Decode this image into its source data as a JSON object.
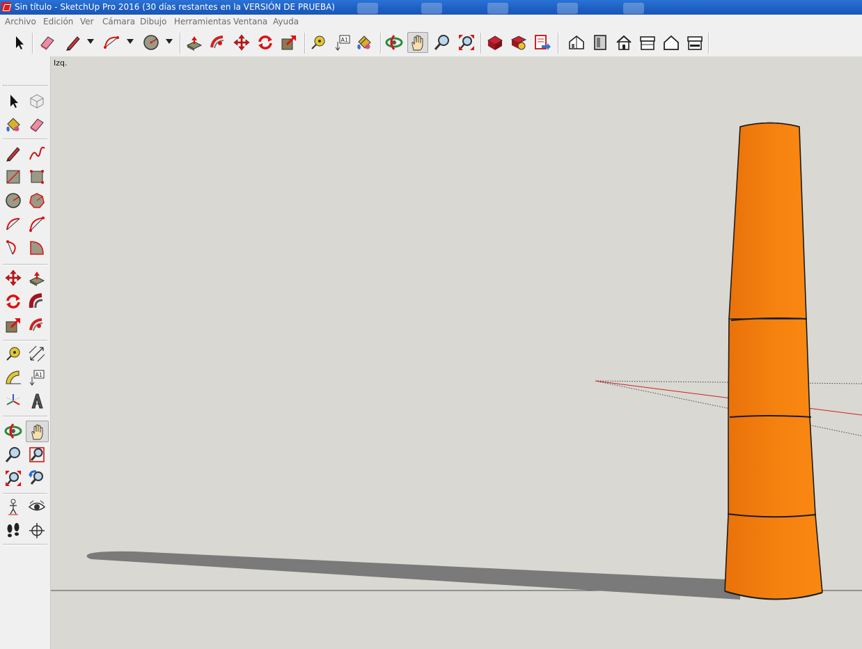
{
  "window": {
    "title": "Sin título - SketchUp Pro 2016 (30 días restantes en la VERSIÓN DE PRUEBA)"
  },
  "menu": {
    "items": [
      "Archivo",
      "Edición",
      "Ver",
      "Cámara",
      "Dibujo",
      "Herramientas",
      "Ventana",
      "Ayuda"
    ]
  },
  "toolbar": {
    "tools": [
      "select-icon",
      "eraser-icon",
      "pencil-icon",
      "arc-icon",
      "circle-icon",
      "push-pull-icon",
      "follow-me-icon",
      "move-icon",
      "rotate-icon",
      "scale-icon",
      "tape-measure-icon",
      "text-icon",
      "paint-bucket-icon",
      "orbit-icon",
      "pan-icon",
      "zoom-icon",
      "zoom-extents-icon",
      "warehouse-icon",
      "extension-warehouse-icon",
      "send-to-layout-icon",
      "iso-view-icon",
      "front-view-icon",
      "top-view-icon",
      "right-view-icon",
      "back-view-icon",
      "left-view-icon"
    ],
    "active_tool": "pan-icon"
  },
  "side_toolbar": {
    "tools": [
      "select-icon",
      "make-component-icon",
      "paint-bucket-icon",
      "eraser-icon",
      "pencil-icon",
      "freehand-icon",
      "rectangle-icon",
      "rotated-rectangle-icon",
      "circle-icon",
      "polygon-icon",
      "arc-icon",
      "two-point-arc-icon",
      "three-point-arc-icon",
      "pie-icon",
      "move-icon",
      "push-pull-icon",
      "rotate-icon",
      "follow-me-icon",
      "scale-icon",
      "offset-icon",
      "tape-measure-icon",
      "dimension-icon",
      "protractor-icon",
      "text-icon",
      "axes-icon",
      "3d-text-icon",
      "orbit-icon",
      "pan-icon",
      "zoom-icon",
      "zoom-window-icon",
      "zoom-extents-icon",
      "previous-view-icon",
      "position-camera-icon",
      "look-around-icon",
      "walk-icon",
      "section-plane-icon"
    ],
    "active_tool": "pan-icon"
  },
  "viewport": {
    "view_label": "Izq.",
    "background_color": "#d9d8d3",
    "model_color": "#f57f0f",
    "shadow_color": "#7a7a7a",
    "axis_red_color": "#cc2020",
    "sky_color": "#d9d8d3",
    "model": "orange tapered cylinder in four stacked segments"
  }
}
